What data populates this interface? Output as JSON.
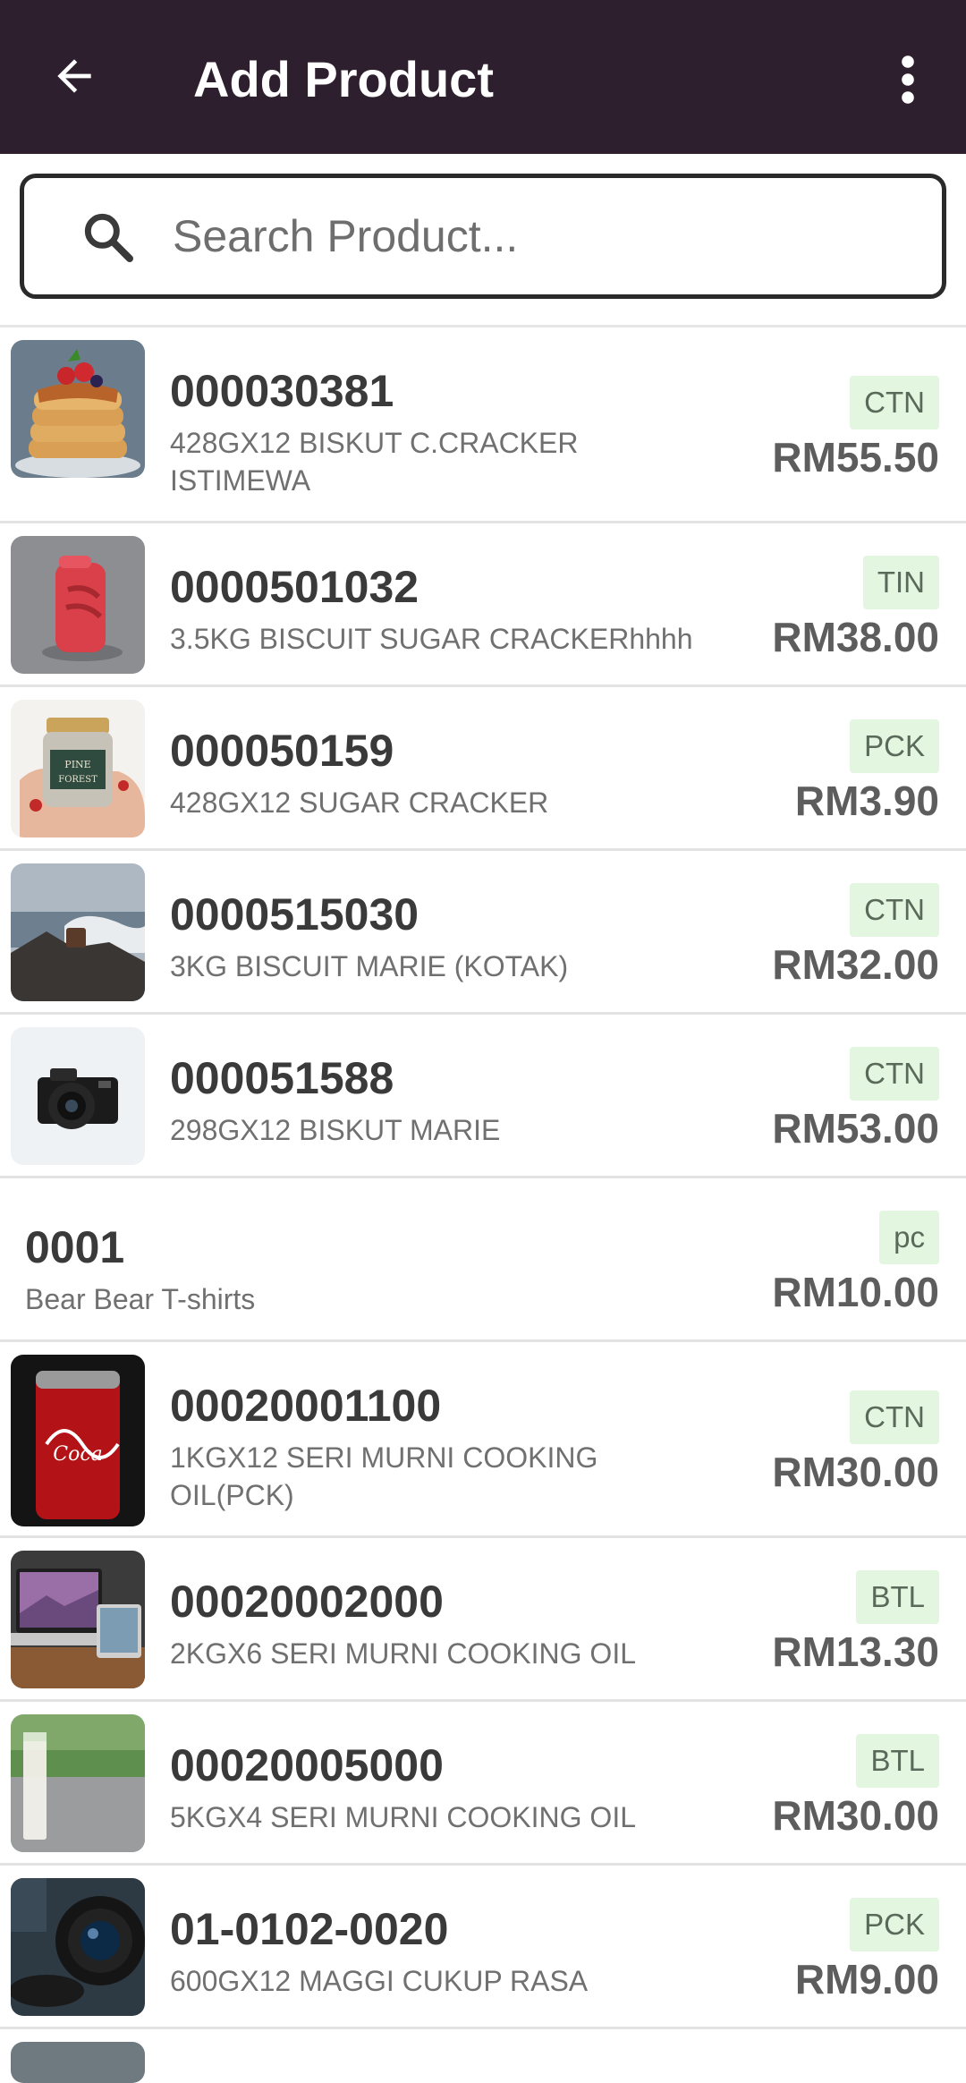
{
  "appbar": {
    "title": "Add Product",
    "back_icon": "arrow-left-icon",
    "menu_icon": "more-vertical-icon",
    "background": "#2e1f2e"
  },
  "search": {
    "placeholder": "Search Product...",
    "value": "",
    "icon": "search-icon"
  },
  "accent": {
    "unit_badge_bg": "#e3f6e0"
  },
  "products": [
    {
      "code": "000030381",
      "desc": "428GX12 BISKUT C.CRACKER ISTIMEWA",
      "unit": "CTN",
      "price": "RM55.50",
      "image": "pancakes"
    },
    {
      "code": "0000501032",
      "desc": "3.5KG BISCUIT SUGAR CRACKERhhhh",
      "unit": "TIN",
      "price": "RM38.00",
      "image": "red-lighter"
    },
    {
      "code": "000050159",
      "desc": "428GX12 SUGAR CRACKER",
      "unit": "PCK",
      "price": "RM3.90",
      "image": "jar"
    },
    {
      "code": "0000515030",
      "desc": "3KG BISCUIT MARIE (KOTAK)",
      "unit": "CTN",
      "price": "RM32.00",
      "image": "sea-rocks"
    },
    {
      "code": "000051588",
      "desc": "298GX12 BISKUT MARIE",
      "unit": "CTN",
      "price": "RM53.00",
      "image": "camera"
    },
    {
      "code": "0001",
      "desc": "Bear Bear T-shirts",
      "unit": "pc",
      "price": "RM10.00",
      "image": ""
    },
    {
      "code": "00020001100",
      "desc": "1KGX12  SERI MURNI COOKING OIL(PCK)",
      "unit": "CTN",
      "price": "RM30.00",
      "image": "cola-can"
    },
    {
      "code": "00020002000",
      "desc": "2KGX6 SERI MURNI COOKING OIL",
      "unit": "BTL",
      "price": "RM13.30",
      "image": "laptop"
    },
    {
      "code": "00020005000",
      "desc": "5KGX4 SERI MURNI COOKING OIL",
      "unit": "BTL",
      "price": "RM30.00",
      "image": "milk-glass"
    },
    {
      "code": "01-0102-0020",
      "desc": "600GX12 MAGGI CUKUP RASA",
      "unit": "PCK",
      "price": "RM9.00",
      "image": "lens"
    }
  ]
}
